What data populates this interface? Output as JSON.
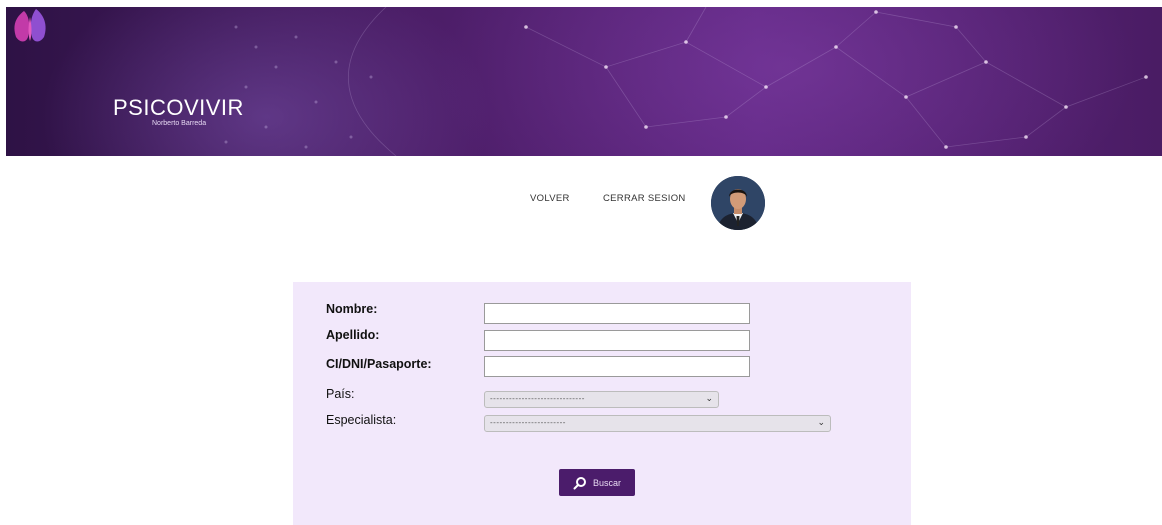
{
  "header": {
    "logo_title": "PSICOVIVIR",
    "logo_subtitle": "Norberto Barreda"
  },
  "nav": {
    "volver": "VOLVER",
    "cerrar_sesion": "CERRAR SESION"
  },
  "form": {
    "nombre_label": "Nombre:",
    "apellido_label": "Apellido:",
    "documento_label": "CI/DNI/Pasaporte:",
    "pais_label": "País:",
    "especialista_label": "Especialista:",
    "nombre_value": "",
    "apellido_value": "",
    "documento_value": "",
    "pais_selected": "------------------------------",
    "especialista_selected": "------------------------",
    "search_button": "Buscar"
  },
  "icons": {
    "search": "search-icon",
    "dropdown": "chevron-down-icon",
    "avatar": "user-avatar"
  },
  "colors": {
    "banner_dark": "#2e1245",
    "banner_mid": "#5d2580",
    "panel_bg": "#f2e8fb",
    "button_bg": "#4b1c6b"
  }
}
